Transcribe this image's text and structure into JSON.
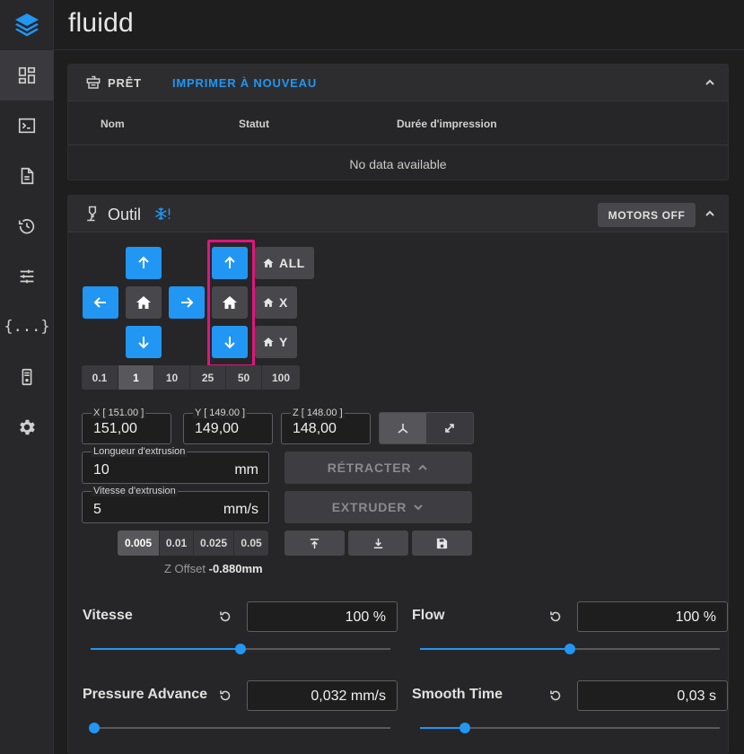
{
  "app": {
    "title": "fluidd",
    "accent": "#2196f3",
    "highlight_color": "#e0157e"
  },
  "sidebar": {
    "items": [
      {
        "icon": "dashboard-icon",
        "active": true
      },
      {
        "icon": "console-icon"
      },
      {
        "icon": "file-icon"
      },
      {
        "icon": "history-icon"
      },
      {
        "icon": "tune-icon"
      },
      {
        "icon": "macros-icon",
        "glyph": "{...}"
      },
      {
        "icon": "printer-icon"
      },
      {
        "icon": "settings-icon"
      }
    ]
  },
  "status_card": {
    "title": "PRÊT",
    "reprint_label": "IMPRIMER À NOUVEAU",
    "columns": [
      "Nom",
      "Statut",
      "Durée d'impression"
    ],
    "empty_text": "No data available"
  },
  "tool_card": {
    "title": "Outil",
    "motors_off_label": "MOTORS OFF",
    "home_all_label": "ALL",
    "home_x_label": "X",
    "home_y_label": "Y",
    "steps": [
      "0.1",
      "1",
      "10",
      "25",
      "50",
      "100"
    ],
    "active_step": "1",
    "position": {
      "x_label": "X [ 151.00 ]",
      "x_value": "151,00",
      "y_label": "Y [ 149.00 ]",
      "y_value": "149,00",
      "z_label": "Z [ 148.00 ]",
      "z_value": "148,00"
    },
    "extrude_length": {
      "label": "Longueur d'extrusion",
      "value": "10",
      "unit": "mm"
    },
    "extrude_speed": {
      "label": "Vitesse d'extrusion",
      "value": "5",
      "unit": "mm/s"
    },
    "retract_label": "RÉTRACTER",
    "extrude_label": "EXTRUDER",
    "z_distances": [
      "0.005",
      "0.01",
      "0.025",
      "0.05"
    ],
    "active_z_distance": "0.005",
    "z_offset_label": "Z Offset",
    "z_offset_value": "-0.880mm",
    "tuning": {
      "speed": {
        "label": "Vitesse",
        "value": "100 %",
        "level": 0.5
      },
      "flow": {
        "label": "Flow",
        "value": "100 %",
        "level": 0.5
      },
      "pressure_advance": {
        "label": "Pressure Advance",
        "value": "0,032 mm/s",
        "level": 0.0
      },
      "smooth_time": {
        "label": "Smooth Time",
        "value": "0,03 s",
        "level": 0.15
      }
    }
  }
}
